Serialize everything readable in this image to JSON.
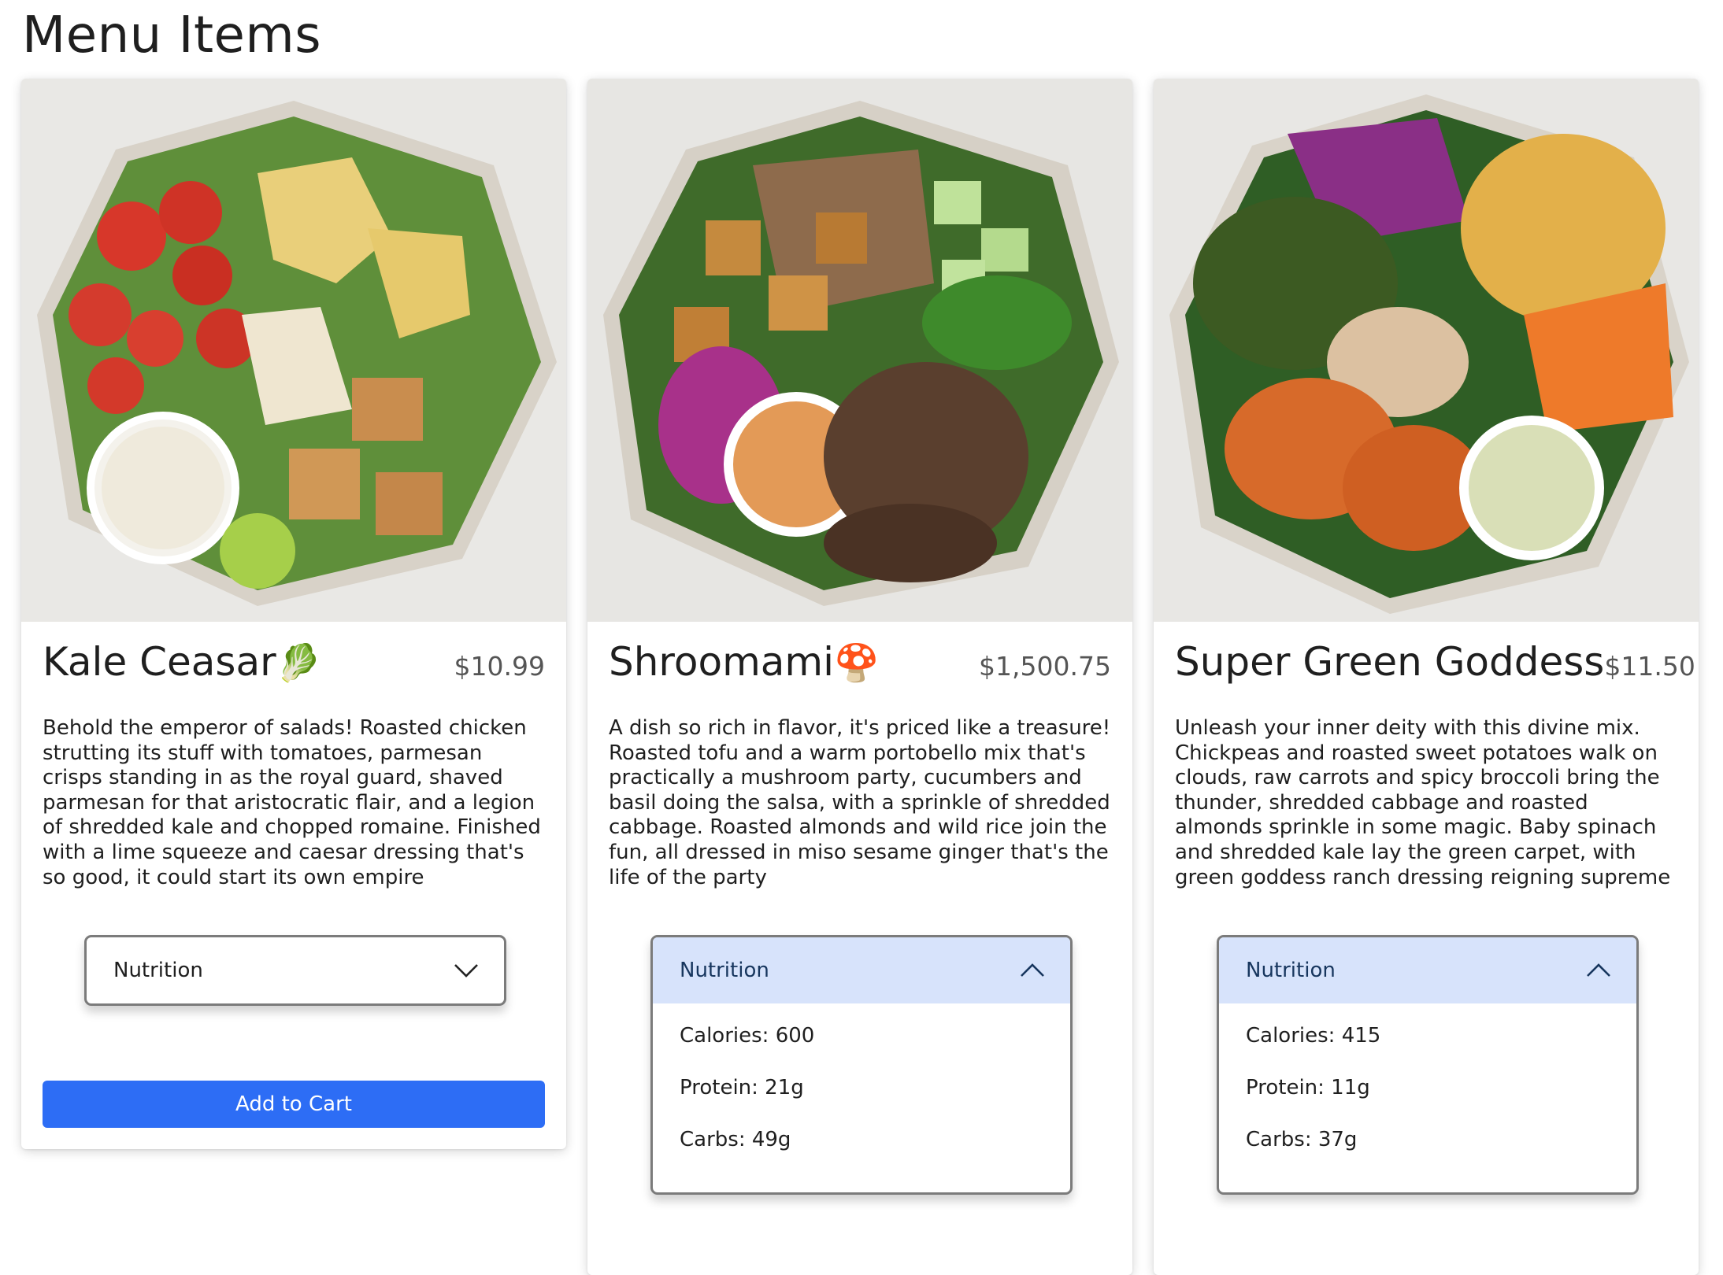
{
  "page": {
    "title": "Menu Items"
  },
  "items": [
    {
      "name": "Kale Ceasar",
      "emoji": "🥬",
      "price": "$10.99",
      "description": "Behold the emperor of salads! Roasted chicken strutting its stuff with tomatoes, parmesan crisps standing in as the royal guard, shaved parmesan for that aristocratic flair, and a legion of shredded kale and chopped romaine. Finished with a lime squeeze and caesar dressing that's so good, it could start its own empire",
      "nutrition_label": "Nutrition",
      "nutrition_open": false,
      "add_to_cart": "Add to Cart"
    },
    {
      "name": "Shroomami",
      "emoji": "🍄",
      "price": "$1,500.75",
      "description": "A dish so rich in flavor, it's priced like a treasure! Roasted tofu and a warm portobello mix that's practically a mushroom party, cucumbers and basil doing the salsa, with a sprinkle of shredded cabbage. Roasted almonds and wild rice join the fun, all dressed in miso sesame ginger that's the life of the party",
      "nutrition_label": "Nutrition",
      "nutrition_open": true,
      "calories": "Calories: 600",
      "protein": "Protein: 21g",
      "carbs": "Carbs: 49g"
    },
    {
      "name": "Super Green Goddess",
      "price": "$11.50",
      "description": "Unleash your inner deity with this divine mix. Chickpeas and roasted sweet potatoes walk on clouds, raw carrots and spicy broccoli bring the thunder, shredded cabbage and roasted almonds sprinkle in some magic. Baby spinach and shredded kale lay the green carpet, with green goddess ranch dressing reigning supreme",
      "nutrition_label": "Nutrition",
      "nutrition_open": true,
      "calories": "Calories: 415",
      "protein": "Protein: 11g",
      "carbs": "Carbs: 37g"
    }
  ],
  "colors": {
    "accent_button": "#2d6df5",
    "accordion_open_header": "#d7e3fb"
  },
  "icons": {
    "collapsed": "chevron-down-icon",
    "expanded": "chevron-up-icon"
  }
}
